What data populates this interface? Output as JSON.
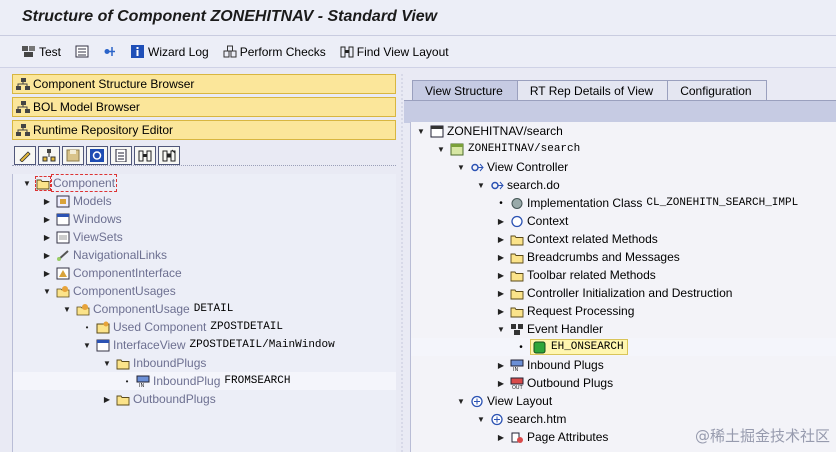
{
  "window": {
    "title": "Structure of Component ZONEHITNAV - Standard View"
  },
  "toolbar": {
    "items": [
      {
        "label": "Test",
        "icon": "test-icon"
      },
      {
        "label": "",
        "icon": "detail-icon"
      },
      {
        "label": "",
        "icon": "navigate-icon"
      },
      {
        "label": "Wizard Log",
        "icon": "info-icon"
      },
      {
        "label": "Perform Checks",
        "icon": "check-icon"
      },
      {
        "label": "Find View Layout",
        "icon": "binoculars-icon"
      }
    ]
  },
  "left_panel": {
    "buttons": [
      "Component Structure Browser",
      "BOL Model Browser",
      "Runtime Repository Editor"
    ],
    "icon_buttons": [
      "edit-icon",
      "hierarchy-icon",
      "save-icon",
      "refresh-icon",
      "document-icon",
      "find-icon",
      "find-next-icon"
    ],
    "tree": [
      {
        "label": "Component",
        "mono": "",
        "icon": "folder-icon",
        "arrow": "down",
        "indent": 0
      },
      {
        "label": "Models",
        "mono": "",
        "icon": "model-icon",
        "arrow": "right",
        "indent": 1
      },
      {
        "label": "Windows",
        "mono": "",
        "icon": "window-icon",
        "arrow": "right",
        "indent": 1
      },
      {
        "label": "ViewSets",
        "mono": "",
        "icon": "viewset-icon",
        "arrow": "right",
        "indent": 1
      },
      {
        "label": "NavigationalLinks",
        "mono": "",
        "icon": "link-icon",
        "arrow": "right",
        "indent": 1
      },
      {
        "label": "ComponentInterface",
        "mono": "",
        "icon": "interface-icon",
        "arrow": "right",
        "indent": 1
      },
      {
        "label": "ComponentUsages",
        "mono": "",
        "icon": "usage-icon",
        "arrow": "down",
        "indent": 1
      },
      {
        "label": "ComponentUsage",
        "mono": "DETAIL",
        "icon": "usage-icon",
        "arrow": "down",
        "indent": 2
      },
      {
        "label": "Used Component",
        "mono": "ZPOSTDETAIL",
        "icon": "component-icon",
        "arrow": "bullet",
        "indent": 3
      },
      {
        "label": "InterfaceView",
        "mono": "ZPOSTDETAIL/MainWindow",
        "icon": "window-icon",
        "arrow": "down",
        "indent": 3
      },
      {
        "label": "InboundPlugs",
        "mono": "",
        "icon": "folder-icon",
        "arrow": "down",
        "indent": 4
      },
      {
        "label": "InboundPlug",
        "mono": "FROMSEARCH",
        "icon": "inbound-plug-icon",
        "arrow": "bullet",
        "indent": 5
      },
      {
        "label": "OutboundPlugs",
        "mono": "",
        "icon": "folder-icon",
        "arrow": "right",
        "indent": 4
      }
    ]
  },
  "right_panel": {
    "tabs": [
      "View Structure",
      "RT Rep Details of View",
      "Configuration"
    ],
    "active_tab": 0,
    "tree": [
      {
        "label": "ZONEHITNAV/search",
        "mono": false,
        "icon": "view-icon",
        "arrow": "down",
        "indent": 0
      },
      {
        "label": "ZONEHITNAV/search",
        "mono": true,
        "icon": "view-green-icon",
        "arrow": "down",
        "indent": 1
      },
      {
        "label": "View Controller",
        "mono": false,
        "icon": "controller-icon",
        "arrow": "down",
        "indent": 2
      },
      {
        "label": "search.do",
        "mono": false,
        "icon": "controller-icon",
        "arrow": "down",
        "indent": 3
      },
      {
        "label": "Implementation Class",
        "mono_value": "CL_ZONEHITN_SEARCH_IMPL",
        "icon": "class-icon",
        "arrow": "bullet",
        "indent": 4
      },
      {
        "label": "Context",
        "icon": "context-icon",
        "arrow": "right",
        "indent": 4
      },
      {
        "label": "Context related Methods",
        "icon": "folder-icon",
        "arrow": "right",
        "indent": 4
      },
      {
        "label": "Breadcrumbs and Messages",
        "icon": "folder-icon",
        "arrow": "right",
        "indent": 4
      },
      {
        "label": "Toolbar related Methods",
        "icon": "folder-icon",
        "arrow": "right",
        "indent": 4
      },
      {
        "label": "Controller Initialization and Destruction",
        "icon": "folder-icon",
        "arrow": "right",
        "indent": 4
      },
      {
        "label": "Request Processing",
        "icon": "folder-icon",
        "arrow": "right",
        "indent": 4
      },
      {
        "label": "Event Handler",
        "icon": "event-handler-icon",
        "arrow": "down",
        "indent": 4
      },
      {
        "label": "EH_ONSEARCH",
        "mono": true,
        "icon": "green-light-icon",
        "arrow": "bullet",
        "indent": 5,
        "selected": true
      },
      {
        "label": "Inbound Plugs",
        "icon": "inbound-plug-icon",
        "arrow": "right",
        "indent": 4
      },
      {
        "label": "Outbound Plugs",
        "icon": "outbound-plug-icon",
        "arrow": "right",
        "indent": 4
      },
      {
        "label": "View Layout",
        "icon": "layout-icon",
        "arrow": "down",
        "indent": 2
      },
      {
        "label": "search.htm",
        "icon": "layout-icon",
        "arrow": "down",
        "indent": 3
      },
      {
        "label": "Page Attributes",
        "icon": "attributes-icon",
        "arrow": "right",
        "indent": 4
      }
    ]
  },
  "watermark": "@稀土掘金技术社区"
}
